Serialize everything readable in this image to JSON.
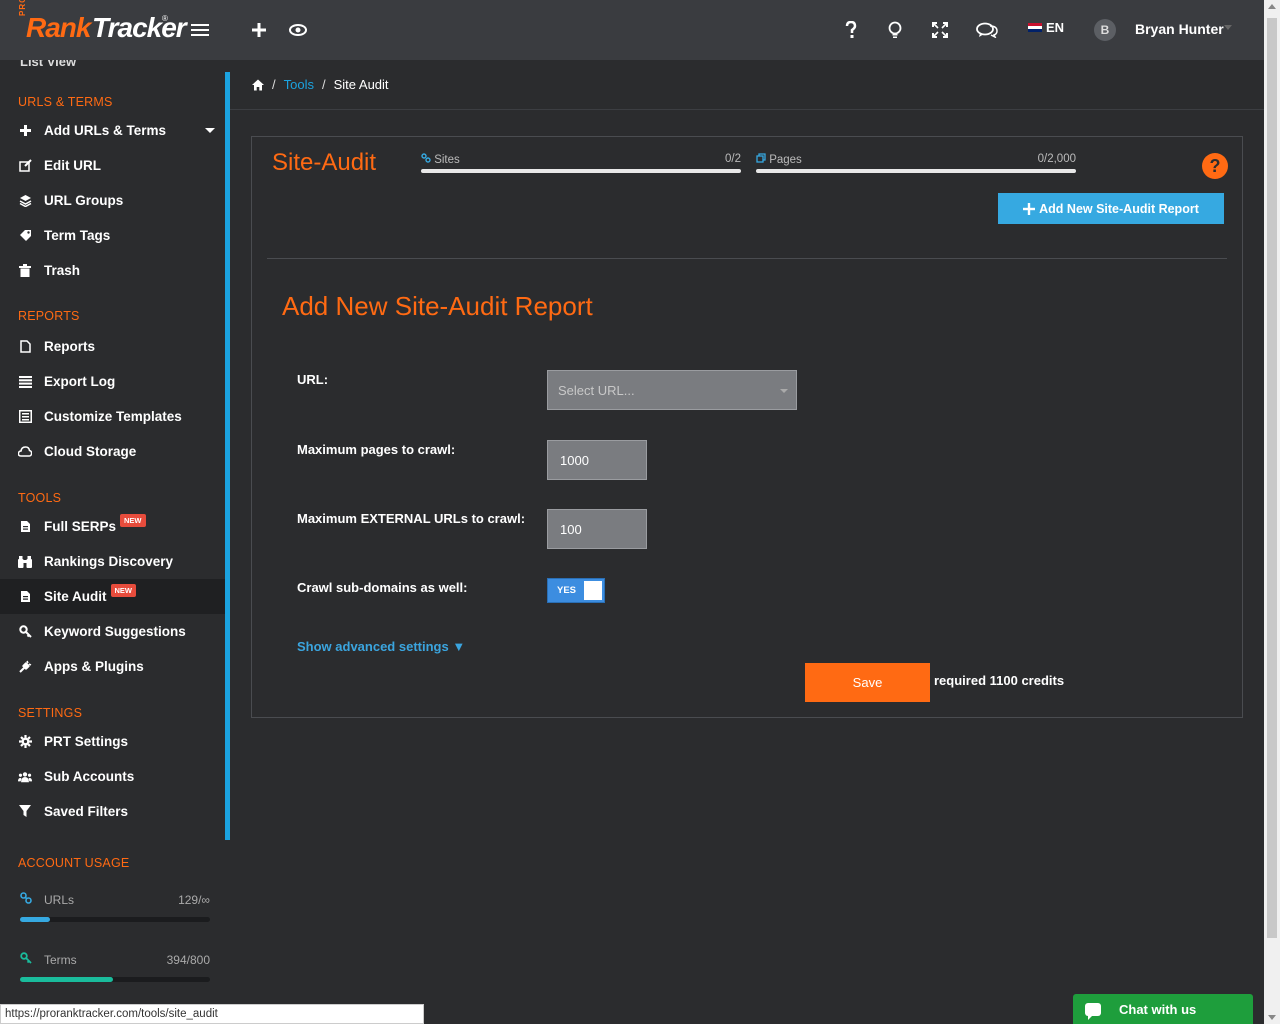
{
  "header": {
    "logo": {
      "pro": "PRO",
      "rank": "Rank",
      "tracker": "Tracker",
      "reg": "®"
    },
    "icons": [
      "hamburger-icon",
      "plus-icon",
      "eye-icon",
      "question-icon",
      "lightbulb-icon",
      "fullscreen-icon",
      "chat-icon"
    ],
    "language": "EN",
    "avatar_initial": "B",
    "username": "Bryan Hunter"
  },
  "sidebar": {
    "cut_item": "List View",
    "sections": [
      {
        "title": "URLS & TERMS",
        "items": [
          {
            "label": "Add URLs & Terms",
            "icon": "plus-icon"
          },
          {
            "label": "Edit URL",
            "icon": "edit-icon"
          },
          {
            "label": "URL Groups",
            "icon": "layers-icon"
          },
          {
            "label": "Term Tags",
            "icon": "tag-icon"
          },
          {
            "label": "Trash",
            "icon": "trash-icon"
          }
        ]
      },
      {
        "title": "REPORTS",
        "items": [
          {
            "label": "Reports",
            "icon": "file-icon"
          },
          {
            "label": "Export Log",
            "icon": "list-icon"
          },
          {
            "label": "Customize Templates",
            "icon": "template-icon"
          },
          {
            "label": "Cloud Storage",
            "icon": "cloud-icon"
          }
        ]
      },
      {
        "title": "TOOLS",
        "items": [
          {
            "label": "Full SERPs",
            "icon": "file-text-icon",
            "badge": "NEW"
          },
          {
            "label": "Rankings Discovery",
            "icon": "binoculars-icon"
          },
          {
            "label": "Site Audit",
            "icon": "file-text-icon",
            "badge": "NEW"
          },
          {
            "label": "Keyword Suggestions",
            "icon": "key-icon"
          },
          {
            "label": "Apps & Plugins",
            "icon": "plug-icon"
          }
        ]
      },
      {
        "title": "SETTINGS",
        "items": [
          {
            "label": "PRT Settings",
            "icon": "gear-icon"
          },
          {
            "label": "Sub Accounts",
            "icon": "users-icon"
          },
          {
            "label": "Saved Filters",
            "icon": "filter-icon"
          }
        ]
      },
      {
        "title": "ACCOUNT USAGE"
      }
    ],
    "usage": [
      {
        "label": "URLs",
        "value": "129/∞",
        "fraction": 0.16,
        "color": "#36a9e1"
      },
      {
        "label": "Terms",
        "value": "394/800",
        "fraction": 0.49,
        "color": "#1abc9c"
      }
    ]
  },
  "breadcrumb": {
    "tools": "Tools",
    "current": "Site Audit",
    "sep": "/"
  },
  "panel": {
    "title": "Site-Audit",
    "sites_label": "Sites",
    "sites_value": "0/2",
    "pages_label": "Pages",
    "pages_value": "0/2,000",
    "help": "?",
    "add_button": "Add New Site-Audit Report"
  },
  "form": {
    "title": "Add New Site-Audit Report",
    "url_label": "URL:",
    "url_placeholder": "Select URL...",
    "max_pages_label": "Maximum pages to crawl:",
    "max_pages_value": "1000",
    "max_external_label": "Maximum EXTERNAL URLs to crawl:",
    "max_external_value": "100",
    "crawl_sub_label": "Crawl sub-domains as well:",
    "crawl_sub_toggle": "YES",
    "advanced_link": "Show advanced settings ▼",
    "save_label": "Save",
    "credits_text": "required 1100 credits"
  },
  "status_url": "https://proranktracker.com/tools/site_audit",
  "chat": {
    "label": "Chat with us"
  },
  "colors": {
    "accent": "#ff6a13",
    "link": "#1ba3e0",
    "button_blue": "#36a9e1",
    "chat_green": "#1e9e3c"
  }
}
